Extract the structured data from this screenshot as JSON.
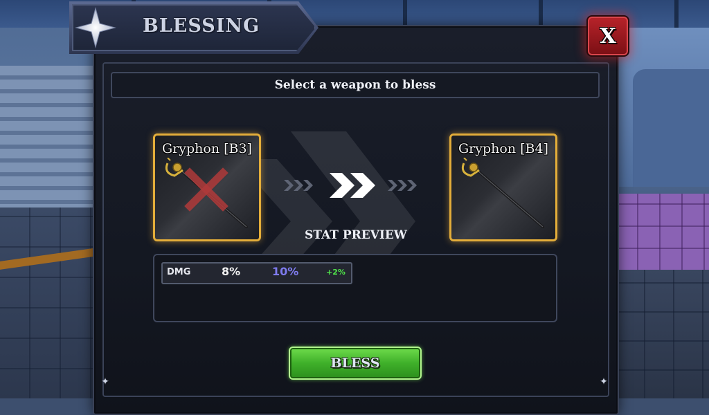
{
  "window": {
    "title": "BLESSING"
  },
  "close_label": "X",
  "instruction": "Select a weapon to bless",
  "current_weapon": {
    "name": "Gryphon [B3]"
  },
  "next_weapon": {
    "name": "Gryphon [B4]"
  },
  "stat_preview": {
    "title": "STAT PREVIEW",
    "stats": [
      {
        "label": "DMG",
        "current": "8%",
        "next": "10%",
        "change": "+2%"
      }
    ]
  },
  "bless_label": "BLESS",
  "colors": {
    "card_border": "#e3ad3a",
    "new_value": "#7f7cf0",
    "change_positive": "#4fe34a",
    "bless_button": "#3fb02a",
    "close_button": "#b8232a"
  },
  "icons": {
    "title": "four-point-star-icon",
    "weapon": "rapier-sword-icon",
    "remove": "red-x-icon",
    "upgrade": "double-chevron-right-icon"
  }
}
